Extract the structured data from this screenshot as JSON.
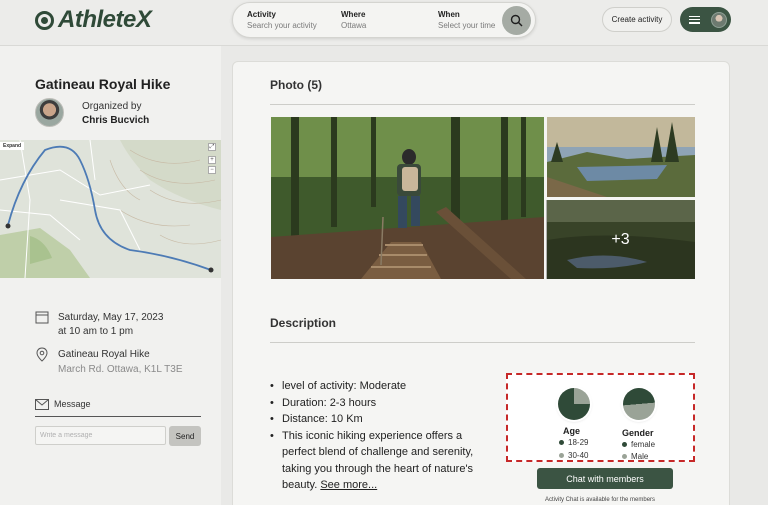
{
  "header": {
    "logo_text": "AthleteX",
    "search": {
      "activity_label": "Activity",
      "activity_placeholder": "Search your activity",
      "where_label": "Where",
      "where_value": "Ottawa",
      "when_label": "When",
      "when_placeholder": "Select your time"
    },
    "create_label": "Create activity"
  },
  "event": {
    "title": "Gatineau Royal Hike",
    "organized_by": "Organized by",
    "organizer": "Chris Bucvich",
    "map_expand": "Expand",
    "date": "Saturday, May 17, 2023",
    "time": "at 10 am to 1 pm",
    "location_name": "Gatineau Royal Hike",
    "location_address": "March Rd. Ottawa, K1L T3E"
  },
  "message": {
    "label": "Message",
    "placeholder": "Write a message",
    "send_label": "Send"
  },
  "photos": {
    "title": "Photo (5)",
    "more_label": "+3"
  },
  "description": {
    "title": "Description",
    "items": [
      "level of activity: Moderate",
      "Duration: 2-3 hours",
      "Distance: 10 Km",
      "This iconic hiking experience offers a perfect blend of challenge and serenity, taking you through the heart of nature's beauty."
    ],
    "see_more": "See more..."
  },
  "stats": {
    "age": {
      "title": "Age",
      "legend": [
        {
          "label": "18-29",
          "color": "#2f4a38",
          "share": 0.75
        },
        {
          "label": "30-40",
          "color": "#9aa397",
          "share": 0.25
        }
      ]
    },
    "gender": {
      "title": "Gender",
      "legend": [
        {
          "label": "female",
          "color": "#2f4a38",
          "share": 0.5
        },
        {
          "label": "Male",
          "color": "#9aa397",
          "share": 0.5
        }
      ]
    }
  },
  "chat": {
    "button_label": "Chat with members",
    "note": "Activity Chat is available for the members"
  },
  "colors": {
    "brand_green": "#2f4a38",
    "accent_green": "#3b5443",
    "highlight_red": "#c62828"
  }
}
